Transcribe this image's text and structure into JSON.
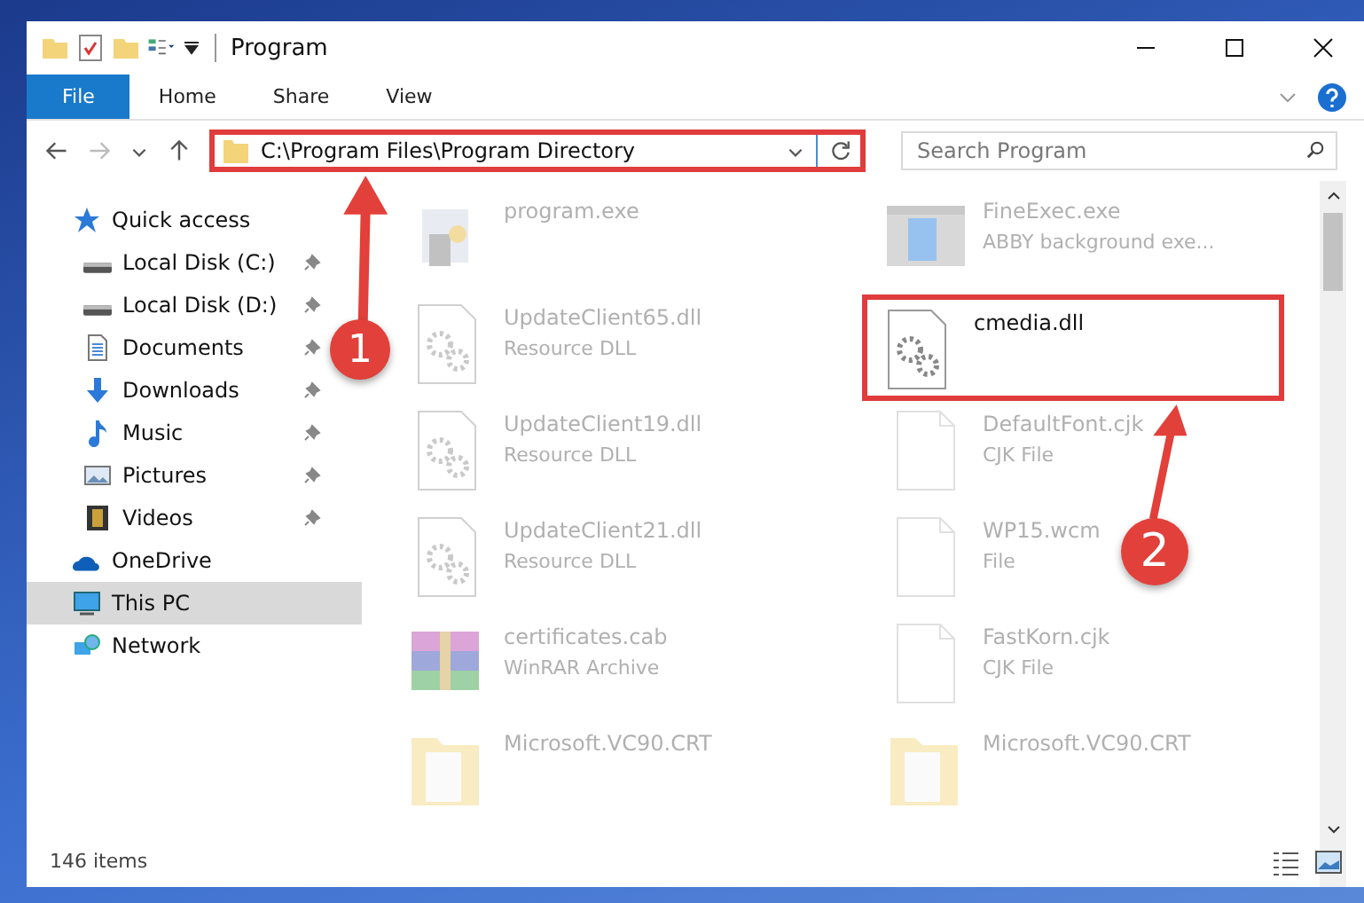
{
  "window": {
    "title": "Program"
  },
  "ribbon_tabs": [
    {
      "label": "File",
      "selected": true
    },
    {
      "label": "Home",
      "selected": false
    },
    {
      "label": "Share",
      "selected": false
    },
    {
      "label": "View",
      "selected": false
    }
  ],
  "address": {
    "path": "C:\\Program Files\\Program Directory"
  },
  "search": {
    "placeholder": "Search Program"
  },
  "sidebar": {
    "items": [
      {
        "label": "Quick access",
        "kind": "star",
        "selected": false,
        "children": [
          {
            "label": "Local Disk (C:)",
            "kind": "disk",
            "pinned": true,
            "selected": false
          },
          {
            "label": "Local Disk (D:)",
            "kind": "disk",
            "pinned": true,
            "selected": false
          },
          {
            "label": "Documents",
            "kind": "document",
            "pinned": true,
            "selected": false
          },
          {
            "label": "Downloads",
            "kind": "download",
            "pinned": true,
            "selected": false
          },
          {
            "label": "Music",
            "kind": "music",
            "pinned": true,
            "selected": false
          },
          {
            "label": "Pictures",
            "kind": "picture",
            "pinned": true,
            "selected": false
          },
          {
            "label": "Videos",
            "kind": "video",
            "pinned": true,
            "selected": false
          }
        ]
      },
      {
        "label": "OneDrive",
        "kind": "cloud",
        "selected": false
      },
      {
        "label": "This PC",
        "kind": "pc",
        "selected": true
      },
      {
        "label": "Network",
        "kind": "network",
        "selected": false
      }
    ]
  },
  "files": [
    {
      "name": "program.exe",
      "kind": "exe",
      "highlighted": false
    },
    {
      "name": "FineExec.exe",
      "type": "ABBY background exe...",
      "kind": "app",
      "highlighted": false
    },
    {
      "name": "UpdateClient65.dll",
      "type": "Resource DLL",
      "kind": "dll",
      "highlighted": false
    },
    {
      "name": "cmedia.dll",
      "kind": "dll",
      "highlighted": true
    },
    {
      "name": "UpdateClient19.dll",
      "type": "Resource DLL",
      "kind": "dll",
      "highlighted": false
    },
    {
      "name": "DefaultFont.cjk",
      "type": "CJK File",
      "kind": "blank",
      "highlighted": false
    },
    {
      "name": "UpdateClient21.dll",
      "type": "Resource DLL",
      "kind": "dll",
      "highlighted": false
    },
    {
      "name": "WP15.wcm",
      "type": "File",
      "kind": "blank",
      "highlighted": false
    },
    {
      "name": "certificates.cab",
      "type": "WinRAR Archive",
      "kind": "archive",
      "highlighted": false
    },
    {
      "name": "FastKorn.cjk",
      "type": "CJK File",
      "kind": "blank",
      "highlighted": false
    },
    {
      "name": "Microsoft.VC90.CRT",
      "kind": "folder",
      "highlighted": false
    },
    {
      "name": "Microsoft.VC90.CRT",
      "kind": "folder",
      "highlighted": false
    }
  ],
  "status_bar": {
    "count": "146 items"
  },
  "annotations": [
    {
      "number": "1"
    },
    {
      "number": "2"
    }
  ]
}
